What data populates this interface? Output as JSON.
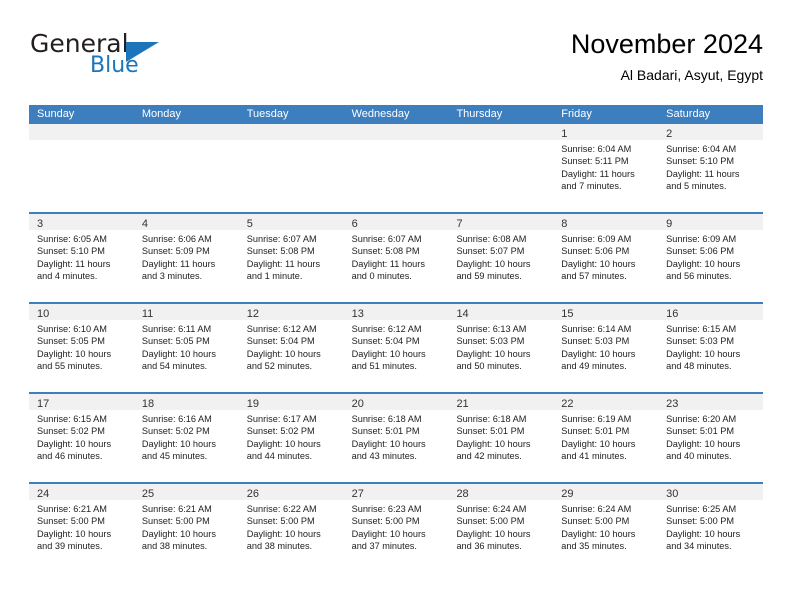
{
  "brand": {
    "name_top": "General",
    "name_bottom": "Blue",
    "accent_color": "#1b75bb",
    "triangle_icon": "brand-triangle-icon"
  },
  "header": {
    "title": "November 2024",
    "subtitle": "Al Badari, Asyut, Egypt"
  },
  "colors": {
    "header_blue": "#3d7ebf",
    "daynum_band": "#f1f1f1",
    "text": "#222222"
  },
  "calendar": {
    "day_headers": [
      "Sunday",
      "Monday",
      "Tuesday",
      "Wednesday",
      "Thursday",
      "Friday",
      "Saturday"
    ],
    "weeks": [
      [
        {
          "day": "",
          "lines": []
        },
        {
          "day": "",
          "lines": []
        },
        {
          "day": "",
          "lines": []
        },
        {
          "day": "",
          "lines": []
        },
        {
          "day": "",
          "lines": []
        },
        {
          "day": "1",
          "lines": [
            "Sunrise: 6:04 AM",
            "Sunset: 5:11 PM",
            "Daylight: 11 hours",
            "and 7 minutes."
          ]
        },
        {
          "day": "2",
          "lines": [
            "Sunrise: 6:04 AM",
            "Sunset: 5:10 PM",
            "Daylight: 11 hours",
            "and 5 minutes."
          ]
        }
      ],
      [
        {
          "day": "3",
          "lines": [
            "Sunrise: 6:05 AM",
            "Sunset: 5:10 PM",
            "Daylight: 11 hours",
            "and 4 minutes."
          ]
        },
        {
          "day": "4",
          "lines": [
            "Sunrise: 6:06 AM",
            "Sunset: 5:09 PM",
            "Daylight: 11 hours",
            "and 3 minutes."
          ]
        },
        {
          "day": "5",
          "lines": [
            "Sunrise: 6:07 AM",
            "Sunset: 5:08 PM",
            "Daylight: 11 hours",
            "and 1 minute."
          ]
        },
        {
          "day": "6",
          "lines": [
            "Sunrise: 6:07 AM",
            "Sunset: 5:08 PM",
            "Daylight: 11 hours",
            "and 0 minutes."
          ]
        },
        {
          "day": "7",
          "lines": [
            "Sunrise: 6:08 AM",
            "Sunset: 5:07 PM",
            "Daylight: 10 hours",
            "and 59 minutes."
          ]
        },
        {
          "day": "8",
          "lines": [
            "Sunrise: 6:09 AM",
            "Sunset: 5:06 PM",
            "Daylight: 10 hours",
            "and 57 minutes."
          ]
        },
        {
          "day": "9",
          "lines": [
            "Sunrise: 6:09 AM",
            "Sunset: 5:06 PM",
            "Daylight: 10 hours",
            "and 56 minutes."
          ]
        }
      ],
      [
        {
          "day": "10",
          "lines": [
            "Sunrise: 6:10 AM",
            "Sunset: 5:05 PM",
            "Daylight: 10 hours",
            "and 55 minutes."
          ]
        },
        {
          "day": "11",
          "lines": [
            "Sunrise: 6:11 AM",
            "Sunset: 5:05 PM",
            "Daylight: 10 hours",
            "and 54 minutes."
          ]
        },
        {
          "day": "12",
          "lines": [
            "Sunrise: 6:12 AM",
            "Sunset: 5:04 PM",
            "Daylight: 10 hours",
            "and 52 minutes."
          ]
        },
        {
          "day": "13",
          "lines": [
            "Sunrise: 6:12 AM",
            "Sunset: 5:04 PM",
            "Daylight: 10 hours",
            "and 51 minutes."
          ]
        },
        {
          "day": "14",
          "lines": [
            "Sunrise: 6:13 AM",
            "Sunset: 5:03 PM",
            "Daylight: 10 hours",
            "and 50 minutes."
          ]
        },
        {
          "day": "15",
          "lines": [
            "Sunrise: 6:14 AM",
            "Sunset: 5:03 PM",
            "Daylight: 10 hours",
            "and 49 minutes."
          ]
        },
        {
          "day": "16",
          "lines": [
            "Sunrise: 6:15 AM",
            "Sunset: 5:03 PM",
            "Daylight: 10 hours",
            "and 48 minutes."
          ]
        }
      ],
      [
        {
          "day": "17",
          "lines": [
            "Sunrise: 6:15 AM",
            "Sunset: 5:02 PM",
            "Daylight: 10 hours",
            "and 46 minutes."
          ]
        },
        {
          "day": "18",
          "lines": [
            "Sunrise: 6:16 AM",
            "Sunset: 5:02 PM",
            "Daylight: 10 hours",
            "and 45 minutes."
          ]
        },
        {
          "day": "19",
          "lines": [
            "Sunrise: 6:17 AM",
            "Sunset: 5:02 PM",
            "Daylight: 10 hours",
            "and 44 minutes."
          ]
        },
        {
          "day": "20",
          "lines": [
            "Sunrise: 6:18 AM",
            "Sunset: 5:01 PM",
            "Daylight: 10 hours",
            "and 43 minutes."
          ]
        },
        {
          "day": "21",
          "lines": [
            "Sunrise: 6:18 AM",
            "Sunset: 5:01 PM",
            "Daylight: 10 hours",
            "and 42 minutes."
          ]
        },
        {
          "day": "22",
          "lines": [
            "Sunrise: 6:19 AM",
            "Sunset: 5:01 PM",
            "Daylight: 10 hours",
            "and 41 minutes."
          ]
        },
        {
          "day": "23",
          "lines": [
            "Sunrise: 6:20 AM",
            "Sunset: 5:01 PM",
            "Daylight: 10 hours",
            "and 40 minutes."
          ]
        }
      ],
      [
        {
          "day": "24",
          "lines": [
            "Sunrise: 6:21 AM",
            "Sunset: 5:00 PM",
            "Daylight: 10 hours",
            "and 39 minutes."
          ]
        },
        {
          "day": "25",
          "lines": [
            "Sunrise: 6:21 AM",
            "Sunset: 5:00 PM",
            "Daylight: 10 hours",
            "and 38 minutes."
          ]
        },
        {
          "day": "26",
          "lines": [
            "Sunrise: 6:22 AM",
            "Sunset: 5:00 PM",
            "Daylight: 10 hours",
            "and 38 minutes."
          ]
        },
        {
          "day": "27",
          "lines": [
            "Sunrise: 6:23 AM",
            "Sunset: 5:00 PM",
            "Daylight: 10 hours",
            "and 37 minutes."
          ]
        },
        {
          "day": "28",
          "lines": [
            "Sunrise: 6:24 AM",
            "Sunset: 5:00 PM",
            "Daylight: 10 hours",
            "and 36 minutes."
          ]
        },
        {
          "day": "29",
          "lines": [
            "Sunrise: 6:24 AM",
            "Sunset: 5:00 PM",
            "Daylight: 10 hours",
            "and 35 minutes."
          ]
        },
        {
          "day": "30",
          "lines": [
            "Sunrise: 6:25 AM",
            "Sunset: 5:00 PM",
            "Daylight: 10 hours",
            "and 34 minutes."
          ]
        }
      ]
    ]
  }
}
